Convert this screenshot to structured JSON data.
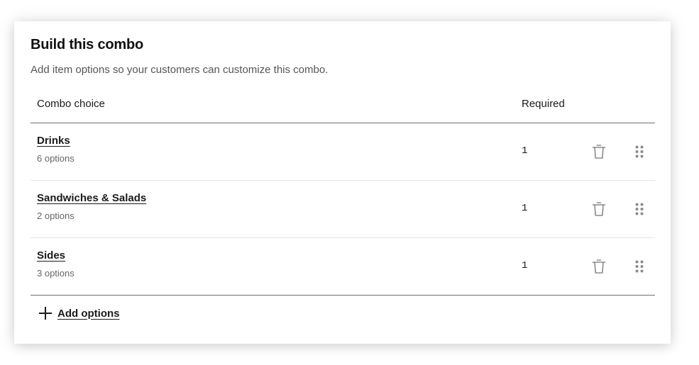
{
  "panel": {
    "title": "Build this combo",
    "subtitle": "Add item options so your customers can customize this combo."
  },
  "table": {
    "headers": {
      "choice": "Combo choice",
      "required": "Required"
    },
    "rows": [
      {
        "name": "Drinks",
        "count": "6 options",
        "required": "1"
      },
      {
        "name": "Sandwiches & Salads",
        "count": "2 options",
        "required": "1"
      },
      {
        "name": "Sides",
        "count": "3 options",
        "required": "1"
      }
    ]
  },
  "actions": {
    "add_options": "Add options"
  },
  "icons": {
    "delete": "trash-icon",
    "reorder": "drag-handle-icon",
    "add": "plus-icon"
  },
  "colors": {
    "text": "#1a1a1a",
    "muted": "#666666",
    "icon": "#8a8a8a",
    "divider_strong": "#6f6f6f",
    "divider_light": "#e6e6e6"
  }
}
